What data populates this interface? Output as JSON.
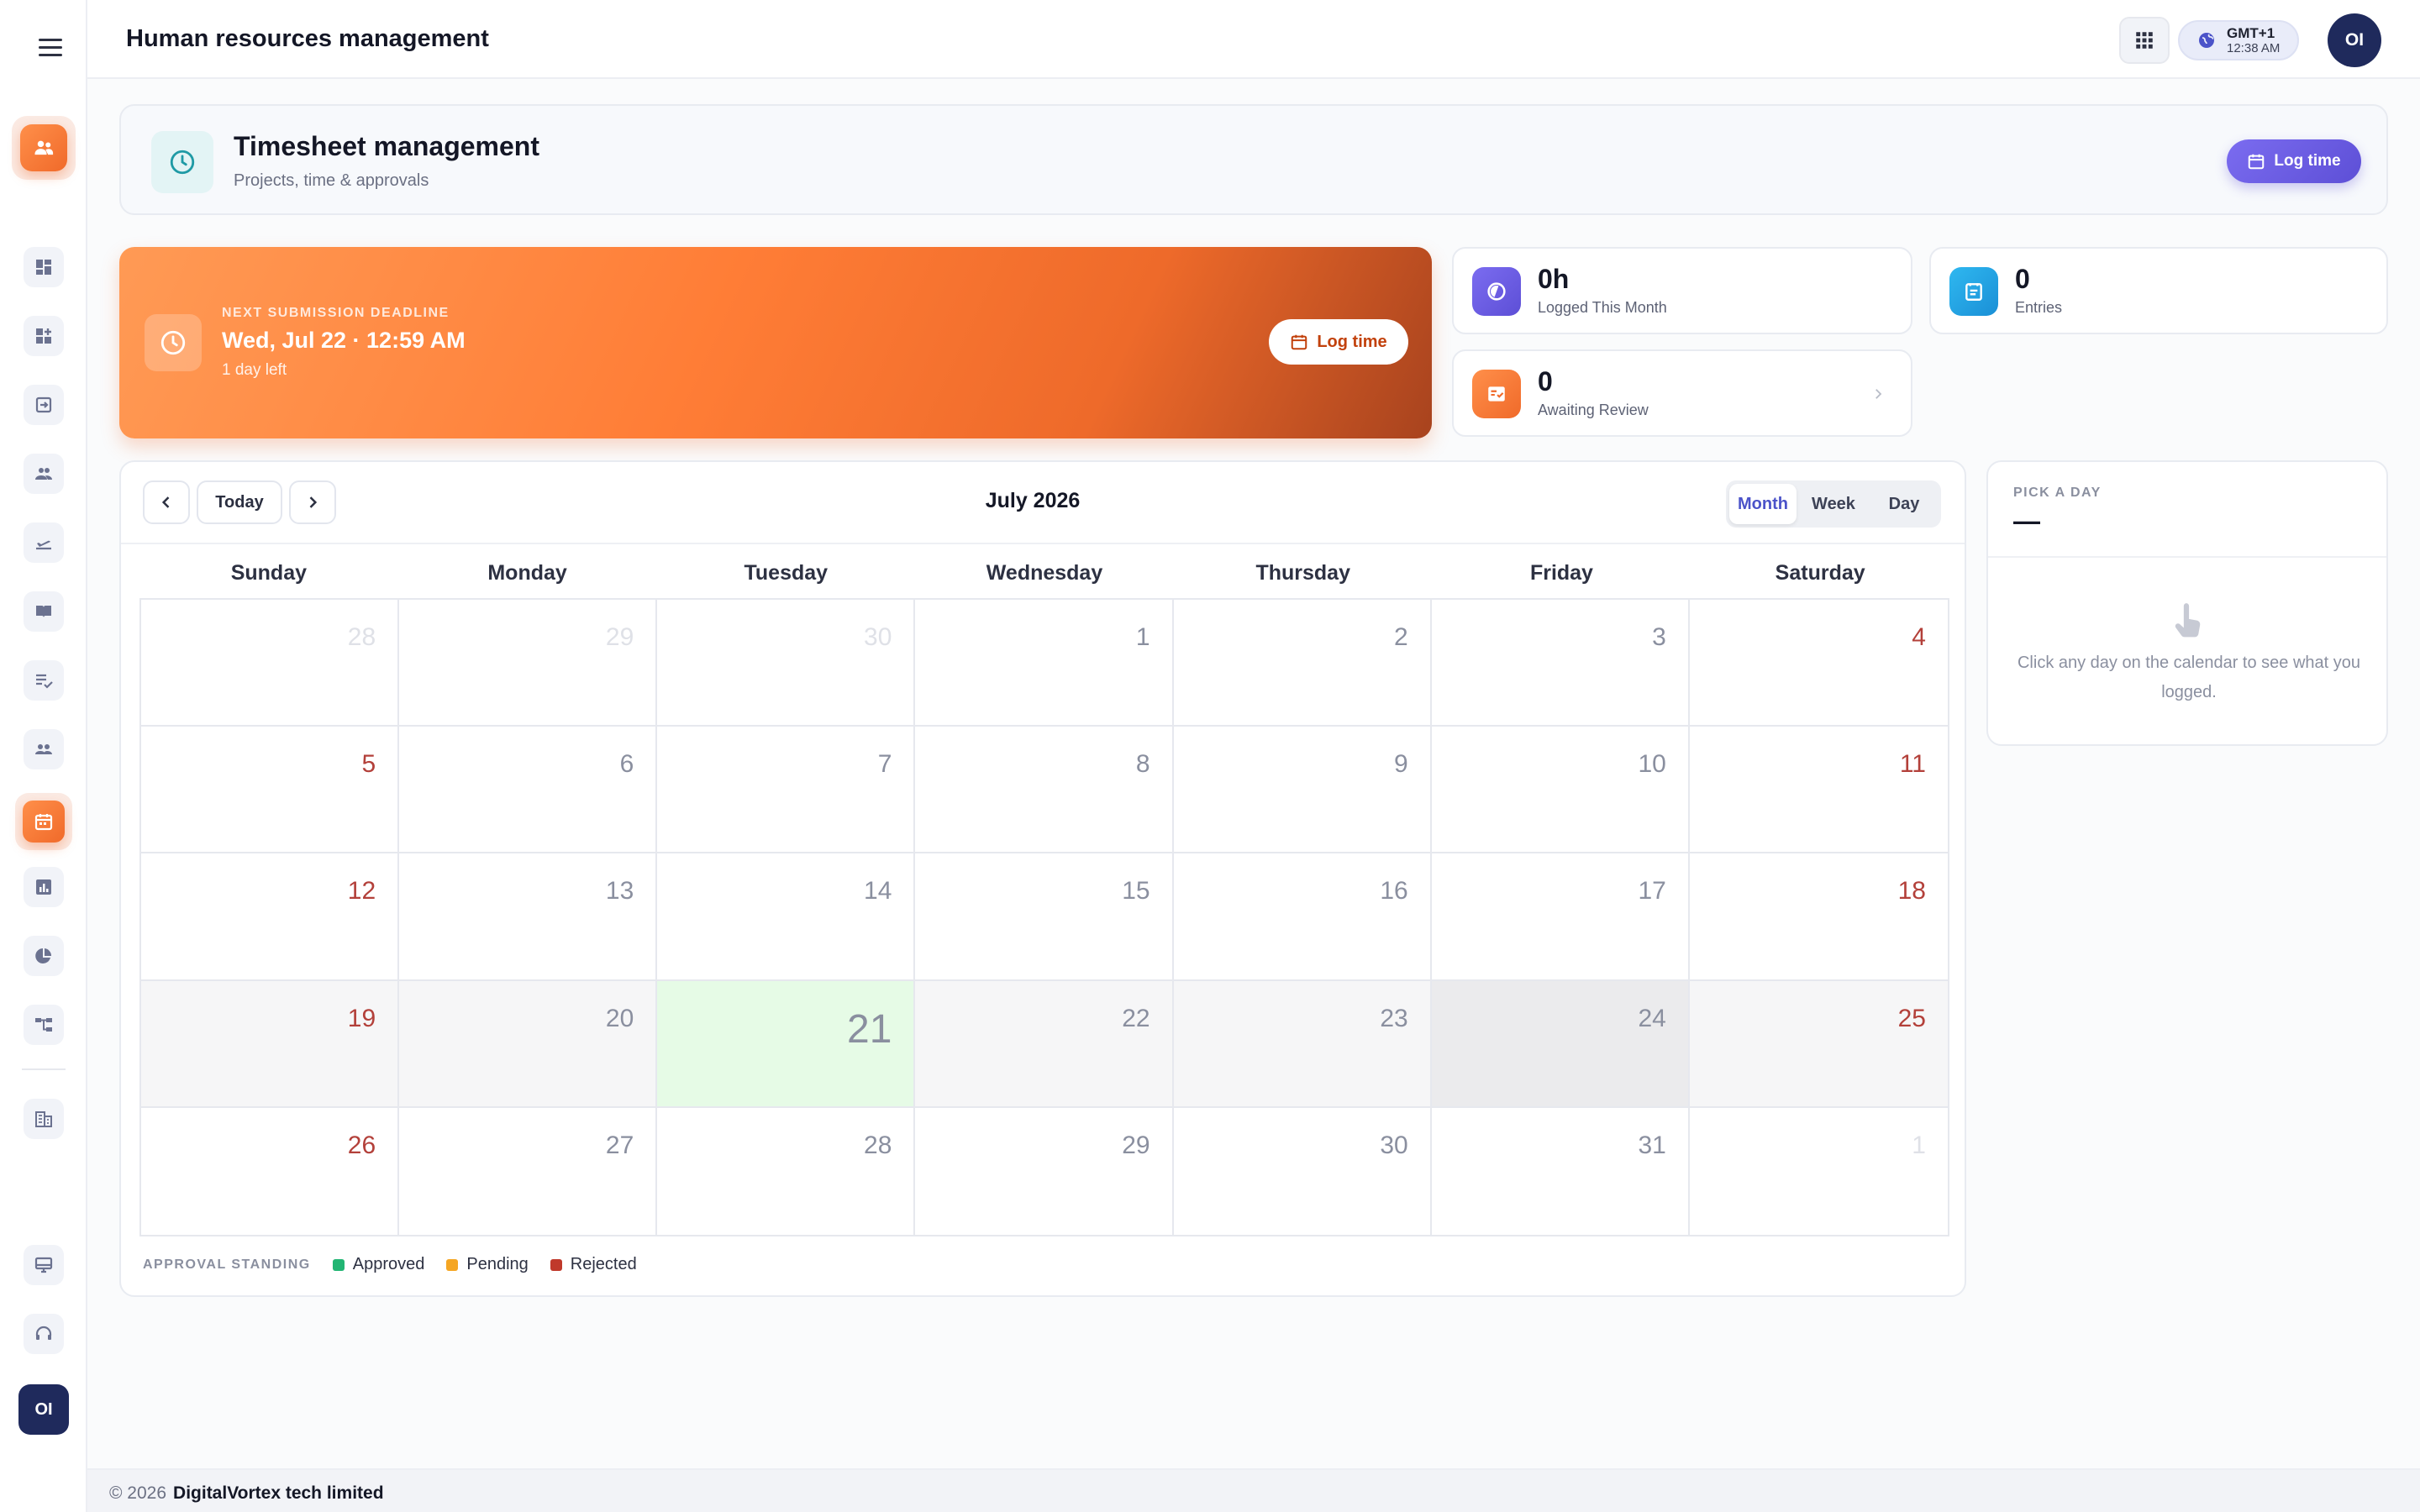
{
  "header": {
    "title": "Human resources management",
    "timezone": "GMT+1",
    "time": "12:38 AM",
    "avatar_initials": "OI"
  },
  "sidebar": {
    "avatar_initials": "OI",
    "items": [
      {
        "icon": "people-icon",
        "active": true
      },
      {
        "icon": "dashboard-icon",
        "active": false
      },
      {
        "icon": "add-widget-icon",
        "active": false
      },
      {
        "icon": "sign-in-icon",
        "active": false
      },
      {
        "icon": "group-icon",
        "active": false
      },
      {
        "icon": "departure-icon",
        "active": false
      },
      {
        "icon": "book-icon",
        "active": false
      },
      {
        "icon": "checklist-icon",
        "active": false
      },
      {
        "icon": "team-icon",
        "active": false
      },
      {
        "icon": "calendar-icon",
        "active": true
      },
      {
        "icon": "bar-chart-icon",
        "active": false
      },
      {
        "icon": "pie-chart-icon",
        "active": false
      },
      {
        "icon": "hierarchy-icon",
        "active": false
      },
      {
        "icon": "building-icon",
        "active": false
      },
      {
        "icon": "desktop-icon",
        "active": false
      },
      {
        "icon": "support-icon",
        "active": false
      }
    ]
  },
  "page": {
    "title": "Timesheet management",
    "subtitle": "Projects, time & approvals",
    "log_time_label": "Log time"
  },
  "banner": {
    "label": "NEXT SUBMISSION DEADLINE",
    "date": "Wed, Jul 22 · 12:59 AM",
    "remaining": "1 day left",
    "button_label": "Log time"
  },
  "stats": {
    "logged": {
      "value": "0h",
      "label": "Logged This Month"
    },
    "entries": {
      "value": "0",
      "label": "Entries"
    },
    "review": {
      "value": "0",
      "label": "Awaiting Review"
    }
  },
  "calendar": {
    "title": "July 2026",
    "today_label": "Today",
    "views": [
      "Month",
      "Week",
      "Day"
    ],
    "active_view": "Month",
    "weekdays": [
      "Sunday",
      "Monday",
      "Tuesday",
      "Wednesday",
      "Thursday",
      "Friday",
      "Saturday"
    ],
    "weeks": [
      [
        "28",
        "29",
        "30",
        "1",
        "2",
        "3",
        "4"
      ],
      [
        "5",
        "6",
        "7",
        "8",
        "9",
        "10",
        "11"
      ],
      [
        "12",
        "13",
        "14",
        "15",
        "16",
        "17",
        "18"
      ],
      [
        "19",
        "20",
        "21",
        "22",
        "23",
        "24",
        "25"
      ],
      [
        "26",
        "27",
        "28",
        "29",
        "30",
        "31",
        "1"
      ]
    ],
    "legend_title": "APPROVAL STANDING",
    "legend": [
      {
        "label": "Approved",
        "color": "#22b573"
      },
      {
        "label": "Pending",
        "color": "#f5a623"
      },
      {
        "label": "Rejected",
        "color": "#c0392b"
      }
    ]
  },
  "day_panel": {
    "label": "PICK A DAY",
    "value": "—",
    "message": "Click any day on the calendar to see what you logged."
  },
  "footer": {
    "copyright": "© 2026",
    "company": "DigitalVortex tech limited"
  },
  "colors": {
    "accent_orange": "#f06a2a",
    "accent_purple": "#5d4fd6",
    "today_bg": "#e6fbe6",
    "weekend_text": "#b3403a"
  }
}
